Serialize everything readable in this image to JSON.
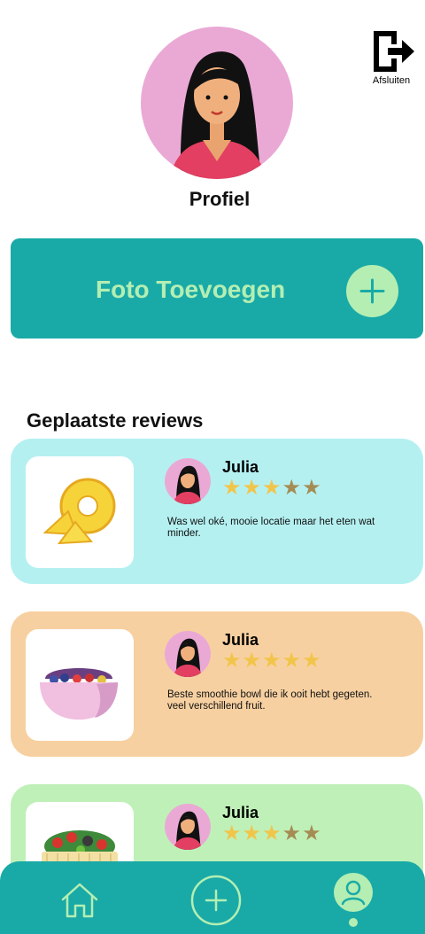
{
  "logout": {
    "label": "Afsluiten",
    "icon": "logout-icon"
  },
  "profile": {
    "title": "Profiel",
    "avatar_icon": "woman-avatar"
  },
  "add_photo": {
    "label": "Foto Toevoegen",
    "icon": "plus-icon"
  },
  "reviews_section": {
    "title": "Geplaatste reviews"
  },
  "reviews": [
    {
      "name": "Julia",
      "rating": 3,
      "max": 5,
      "text": "Was wel oké, mooie locatie maar het eten wat minder.",
      "image": "pineapple-icon",
      "color": "#b5f0f1"
    },
    {
      "name": "Julia",
      "rating": 5,
      "max": 5,
      "text": "Beste smoothie bowl die ik ooit hebt gegeten. veel verschillend fruit.",
      "image": "smoothie-bowl-icon",
      "color": "#f7d0a1"
    },
    {
      "name": "Julia",
      "rating": 3,
      "max": 5,
      "text": "",
      "image": "salad-bowl-icon",
      "color": "#bff0b8"
    }
  ],
  "nav": {
    "items": [
      "home-icon",
      "add-icon",
      "profile-icon"
    ],
    "active": "profile-icon"
  },
  "colors": {
    "primary": "#19aaa7",
    "accent": "#b4eeb3",
    "star": "#f1c54a",
    "star_off": "#a58c53"
  }
}
